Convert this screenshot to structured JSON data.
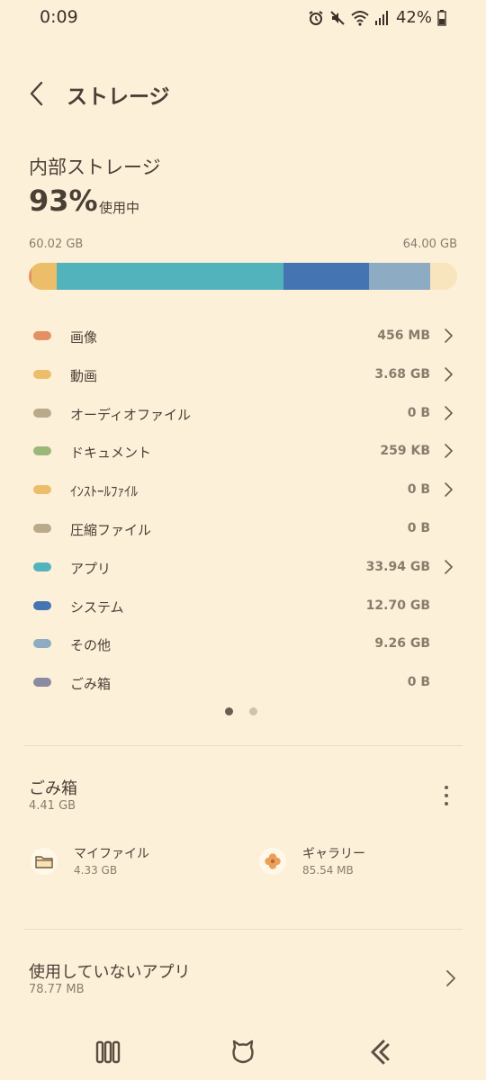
{
  "status_bar": {
    "time": "0:09",
    "battery": "42%",
    "icons": [
      "alarm-icon",
      "mute-icon",
      "wifi-icon",
      "signal-icon",
      "battery-icon"
    ]
  },
  "header": {
    "title": "ストレージ"
  },
  "internal": {
    "title": "内部ストレージ",
    "percent": "93%",
    "in_use": "使用中",
    "used": "60.02 GB",
    "total": "64.00 GB"
  },
  "usage_bar": [
    {
      "name": "画像",
      "fraction": 0.0071,
      "color": "#e49062"
    },
    {
      "name": "動画",
      "fraction": 0.0575,
      "color": "#edbe6a"
    },
    {
      "name": "アプリ",
      "fraction": 0.5303,
      "color": "#52b3bd"
    },
    {
      "name": "システム",
      "fraction": 0.1984,
      "color": "#4574b3"
    },
    {
      "name": "その他",
      "fraction": 0.1447,
      "color": "#8dabc2"
    }
  ],
  "categories": [
    {
      "label": "画像",
      "size": "456 MB",
      "color": "#e49062",
      "chevron": true
    },
    {
      "label": "動画",
      "size": "3.68 GB",
      "color": "#edbe6a",
      "chevron": true
    },
    {
      "label": "オーディオファイル",
      "size": "0 B",
      "color": "#b9aa8a",
      "chevron": true
    },
    {
      "label": "ドキュメント",
      "size": "259 KB",
      "color": "#9cb77a",
      "chevron": true
    },
    {
      "label": "ｲﾝｽﾄｰﾙﾌｧｲﾙ",
      "size": "0 B",
      "color": "#edbe6a",
      "chevron": true
    },
    {
      "label": "圧縮ファイル",
      "size": "0 B",
      "color": "#b9aa8a",
      "chevron": false
    },
    {
      "label": "アプリ",
      "size": "33.94 GB",
      "color": "#52b3bd",
      "chevron": true
    },
    {
      "label": "システム",
      "size": "12.70 GB",
      "color": "#4574b3",
      "chevron": false
    },
    {
      "label": "その他",
      "size": "9.26 GB",
      "color": "#8dabc2",
      "chevron": false
    },
    {
      "label": "ごみ箱",
      "size": "0 B",
      "color": "#8a8aa0",
      "chevron": false
    }
  ],
  "pager": {
    "pages": 2,
    "active": 0
  },
  "trash": {
    "title": "ごみ箱",
    "size": "4.41 GB",
    "items": [
      {
        "name": "マイファイル",
        "size": "4.33 GB",
        "icon": "folder-icon"
      },
      {
        "name": "ギャラリー",
        "size": "85.54 MB",
        "icon": "flower-icon"
      }
    ]
  },
  "unused_apps": {
    "title": "使用していないアプリ",
    "size": "78.77 MB"
  },
  "nav": [
    "recent-apps-icon",
    "home-icon",
    "back-icon"
  ],
  "colors": {
    "background": "#fdf0d9",
    "text": "#4a3f35",
    "secondary": "#8a7c6c"
  }
}
